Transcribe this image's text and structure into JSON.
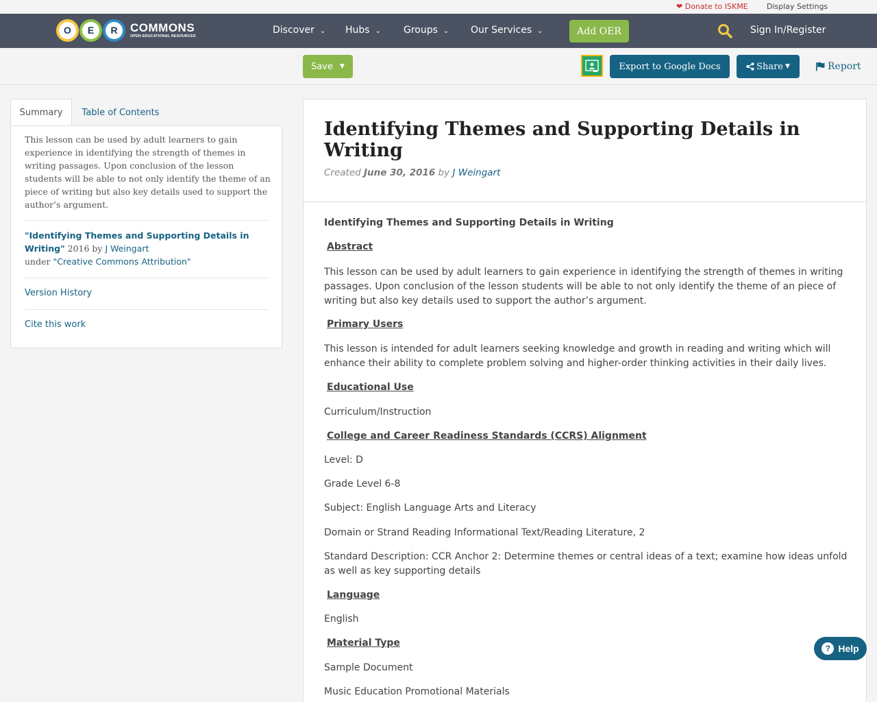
{
  "utility": {
    "donate": "Donate to ISKME",
    "display_settings": "Display Settings"
  },
  "logo": {
    "letters": [
      "O",
      "E",
      "R"
    ],
    "wordmark": "COMMONS",
    "tagline": "OPEN EDUCATIONAL RESOURCES"
  },
  "nav": {
    "items": [
      {
        "label": "Discover"
      },
      {
        "label": "Hubs"
      },
      {
        "label": "Groups"
      },
      {
        "label": "Our Services"
      }
    ],
    "add_oer": "Add OER",
    "sign_in": "Sign In/Register"
  },
  "actions": {
    "save": "Save",
    "export": "Export to Google Docs",
    "share": "Share",
    "report": "Report"
  },
  "sidebar": {
    "tabs": [
      {
        "label": "Summary"
      },
      {
        "label": "Table of Contents"
      }
    ],
    "summary": "This lesson can be used by adult learners to gain experience in identifying the strength of themes in writing passages. Upon conclusion of the lesson students will be able to not only identify the theme of an piece of writing but also key details used to support the author’s argument.",
    "attribution": {
      "title": "\"Identifying Themes and Supporting Details in Writing\"",
      "year_by": " 2016 by ",
      "author": "J Weingart",
      "under": "under ",
      "license": "\"Creative Commons Attribution\""
    },
    "version_history": "Version History",
    "cite": "Cite this work"
  },
  "resource": {
    "title": "Identifying Themes and Supporting Details in Writing",
    "created_label": "Created ",
    "date": "June 30, 2016",
    "by_label": " by ",
    "author": "J Weingart",
    "body": [
      {
        "type": "strong",
        "text": "Identifying Themes and Supporting Details in Writing"
      },
      {
        "type": "head",
        "text": "Abstract"
      },
      {
        "type": "para",
        "text": "This lesson can be used by adult learners to gain experience in identifying the strength of themes in writing passages.  Upon conclusion of the lesson students will be able to not only identify the theme of an piece of writing but also key details used to support the author’s argument."
      },
      {
        "type": "head",
        "text": "Primary Users"
      },
      {
        "type": "para",
        "text": "This lesson is intended for adult learners seeking knowledge and growth in reading and writing which will enhance their ability to complete problem solving and higher-order thinking activities in their daily lives."
      },
      {
        "type": "head",
        "text": "Educational Use"
      },
      {
        "type": "para",
        "text": "Curriculum/Instruction"
      },
      {
        "type": "head",
        "text": "College and Career Readiness Standards (CCRS) Alignment"
      },
      {
        "type": "para",
        "text": "Level: D"
      },
      {
        "type": "para",
        "text": "Grade Level 6-8"
      },
      {
        "type": "para",
        "text": "Subject: English Language Arts and Literacy"
      },
      {
        "type": "para",
        "text": "Domain or Strand Reading Informational Text/Reading Literature, 2"
      },
      {
        "type": "para",
        "text": "Standard Description: CCR Anchor 2: Determine themes or central ideas of a text; examine how ideas unfold as well as key supporting details"
      },
      {
        "type": "head",
        "text": "Language"
      },
      {
        "type": "para",
        "text": "English"
      },
      {
        "type": "head",
        "text": "Material Type "
      },
      {
        "type": "para",
        "text": "Sample Document"
      },
      {
        "type": "para",
        "text": "Music Education Promotional Materials"
      }
    ]
  },
  "help": {
    "label": "Help"
  },
  "colors": {
    "navbar": "#4b5261",
    "green": "#8ab84a",
    "blue": "#166283",
    "donate": "#c9302c"
  }
}
